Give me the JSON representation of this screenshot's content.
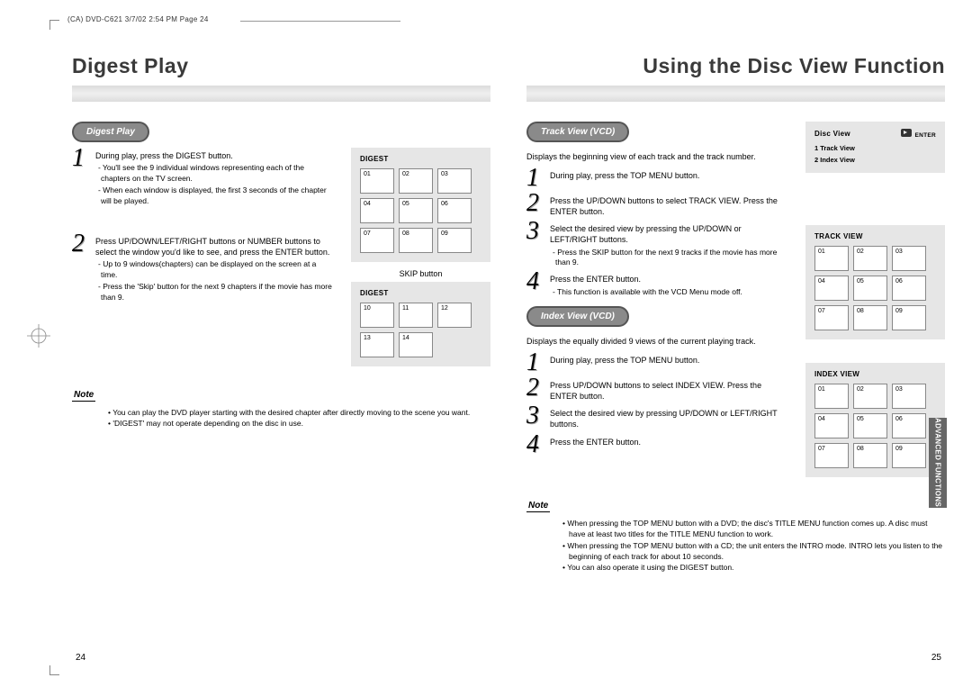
{
  "meta": {
    "header": "(CA) DVD-C621  3/7/02 2:54 PM  Page 24"
  },
  "left": {
    "title": "Digest Play",
    "pill": "Digest Play",
    "step1": {
      "text": "During play, press the DIGEST button.",
      "sub1": "You'll see the 9 individual windows representing each of the chapters on the TV screen.",
      "sub2": "When each window is displayed, the first 3 seconds of the chapter will be played."
    },
    "step2": {
      "text": "Press UP/DOWN/LEFT/RIGHT buttons or NUMBER buttons to select the window you'd like to see, and press the ENTER button.",
      "sub1": "Up to 9 windows(chapters) can be displayed on the screen at a time.",
      "sub2": "Press the 'Skip' button for the next 9 chapters if the movie has more than 9."
    },
    "skip_label": "SKIP button",
    "box1": {
      "caption": "DIGEST",
      "cells": [
        "01",
        "02",
        "03",
        "04",
        "05",
        "06",
        "07",
        "08",
        "09"
      ]
    },
    "box2": {
      "caption": "DIGEST",
      "cells": [
        "10",
        "11",
        "12",
        "13",
        "14"
      ]
    },
    "note_head": "Note",
    "notes": [
      "You can play the DVD player starting with the desired chapter after directly moving to the scene you want.",
      "'DIGEST' may not operate depending on the disc in use."
    ],
    "pagenum": "24"
  },
  "right": {
    "title": "Using the Disc View Function",
    "pillA": "Track View (VCD)",
    "introA": "Displays the beginning view of each track and the track number.",
    "tA1": "During play, press the TOP MENU button.",
    "tA2": "Press the UP/DOWN buttons to select TRACK VIEW. Press the ENTER button.",
    "tA3": "Select the desired view by pressing the UP/DOWN or LEFT/RIGHT buttons.",
    "tA3sub": "Press the SKIP button for the next 9 tracks if the movie has more than 9.",
    "tA4": "Press the ENTER button.",
    "tA4sub": "This function is available with the VCD Menu mode off.",
    "pillB": "Index View (VCD)",
    "introB": "Displays the equally divided 9 views of the current playing track.",
    "iB1": "During play, press the TOP MENU button.",
    "iB2": "Press UP/DOWN buttons to select INDEX VIEW. Press the ENTER button.",
    "iB3": "Select the desired view by pressing UP/DOWN or LEFT/RIGHT buttons.",
    "iB4": "Press the ENTER button.",
    "discview": {
      "caption": "Disc View",
      "enter": "ENTER",
      "line1": "1  Track  View",
      "line2": "2  Index  View"
    },
    "trackview": {
      "caption": "TRACK VIEW",
      "cells": [
        "01",
        "02",
        "03",
        "04",
        "05",
        "06",
        "07",
        "08",
        "09"
      ]
    },
    "indexview": {
      "caption": "INDEX VIEW",
      "cells": [
        "01",
        "02",
        "03",
        "04",
        "05",
        "06",
        "07",
        "08",
        "09"
      ]
    },
    "note_head": "Note",
    "notes": [
      "When pressing the TOP MENU button with a DVD; the disc's TITLE MENU function comes up. A disc must have at least two titles for the TITLE MENU function to work.",
      "When pressing the TOP MENU button with a CD; the unit enters the INTRO mode. INTRO lets you listen to the beginning of each track for about 10 seconds.",
      "You can also operate it using the DIGEST button."
    ],
    "side_tab": "ADVANCED FUNCTIONS",
    "pagenum": "25"
  }
}
